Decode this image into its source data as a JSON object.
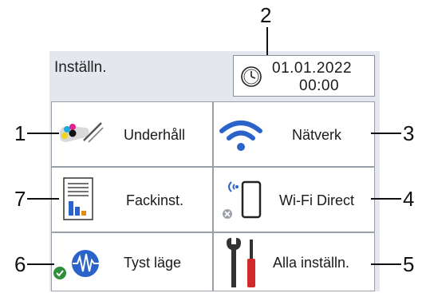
{
  "header": {
    "title": "Inställn."
  },
  "datetime": {
    "date": "01.01.2022",
    "time": "00:00",
    "icon": "clock-icon"
  },
  "tiles": [
    {
      "label": "Underhåll",
      "icon": "ink-maintenance-icon"
    },
    {
      "label": "Nätverk",
      "icon": "wifi-icon"
    },
    {
      "label": "Fackinst.",
      "icon": "tray-settings-icon"
    },
    {
      "label": "Wi-Fi Direct",
      "icon": "wifi-direct-icon"
    },
    {
      "label": "Tyst läge",
      "icon": "quiet-mode-icon"
    },
    {
      "label": "Alla inställn.",
      "icon": "tools-icon"
    }
  ],
  "callouts": [
    "1",
    "2",
    "3",
    "4",
    "5",
    "6",
    "7"
  ],
  "colors": {
    "screen_bg": "#e4e7ee",
    "accent_blue": "#2a63c9",
    "ok_green": "#2f8f3a",
    "tool_red": "#d22a2a"
  }
}
